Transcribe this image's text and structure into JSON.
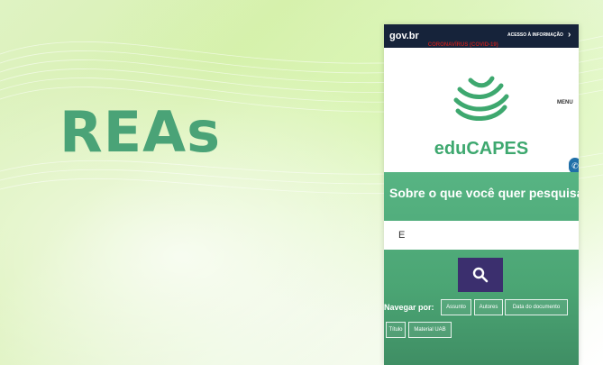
{
  "slide": {
    "title": "REAs"
  },
  "phone": {
    "govbar": {
      "logo": "gov.br",
      "alert_text": "CORONAVÍRUS (COVID-19)",
      "access_info": "ACESSO À INFORMAÇÃO"
    },
    "header": {
      "brand": "eduCAPES",
      "menu_label": "MENU"
    },
    "search": {
      "prompt": "Sobre o que você quer pesquisar?",
      "input_value": "E"
    },
    "browse": {
      "label": "Navegar por:",
      "chips": [
        "Assunto",
        "Autores",
        "Data do documento",
        "Título",
        "Material UAB"
      ]
    },
    "colors": {
      "brand_green": "#3ea86f",
      "search_bg": "#4fae7b",
      "search_button": "#3b2f6e",
      "govbar_bg": "#16233a"
    }
  }
}
